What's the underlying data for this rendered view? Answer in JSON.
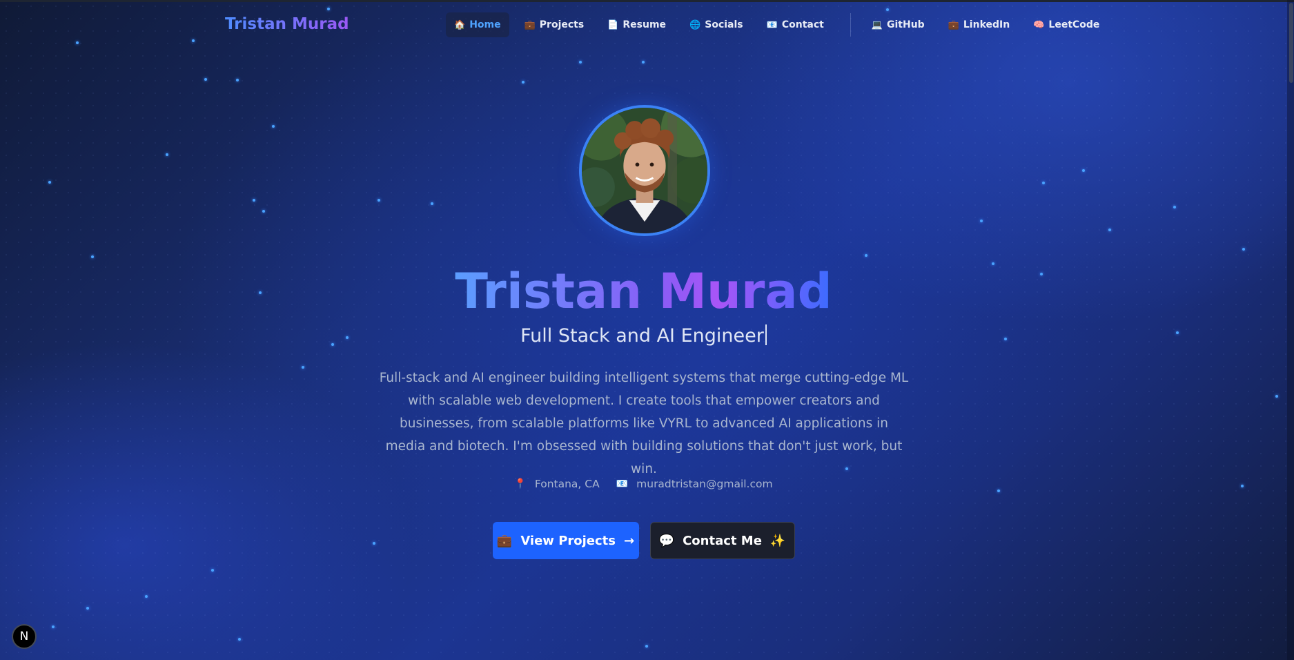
{
  "brand": "Tristan Murad",
  "nav": {
    "items": [
      {
        "icon": "🏠",
        "label": "Home",
        "active": true
      },
      {
        "icon": "💼",
        "label": "Projects"
      },
      {
        "icon": "📄",
        "label": "Resume"
      },
      {
        "icon": "🌐",
        "label": "Socials"
      },
      {
        "icon": "📧",
        "label": "Contact"
      }
    ],
    "external": [
      {
        "icon": "💻",
        "label": "GitHub"
      },
      {
        "icon": "💼",
        "label": "LinkedIn"
      },
      {
        "icon": "🧠",
        "label": "LeetCode"
      }
    ]
  },
  "hero": {
    "name": "Tristan Murad",
    "role": "Full Stack and AI Engineer",
    "description": "Full-stack and AI engineer building intelligent systems that merge cutting-edge ML with scalable web development. I create tools that empower creators and businesses, from scalable platforms like VYRL to advanced AI applications in media and biotech. I'm obsessed with building solutions that don't just work, but win.",
    "location_icon": "📍",
    "location": "Fontana, CA",
    "email_icon": "📧",
    "email": "muradtristan@gmail.com",
    "primary_button": {
      "icon": "💼",
      "label": "View Projects",
      "suffix": "→"
    },
    "secondary_button": {
      "icon": "💬",
      "label": "Contact Me",
      "suffix": "✨"
    }
  },
  "dev_badge": "N",
  "colors": {
    "accent_blue": "#1d63ff",
    "active_nav": "#4fa3ff",
    "gradient_start": "#5b9dff",
    "gradient_mid": "#8b5cf6"
  }
}
